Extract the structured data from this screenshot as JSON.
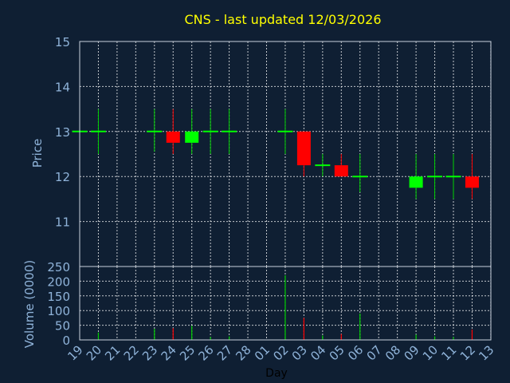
{
  "colors": {
    "background": "#0f1f33",
    "title": "#ffff00",
    "axis_text": "#8fb3d9",
    "frame": "#c8d0dc",
    "grid": "#ffffff",
    "wick": "#00d000",
    "up": "#00ff00",
    "down": "#ff0000",
    "flat": "#00ff00"
  },
  "chart_data": [
    {
      "type": "candlestick",
      "title": "CNS - last updated 12/03/2026",
      "ylabel": "Price",
      "ylim": [
        10,
        15
      ],
      "yticks": [
        11,
        12,
        13,
        14,
        15
      ],
      "grid": true,
      "categories": [
        "19",
        "20",
        "21",
        "22",
        "23",
        "24",
        "25",
        "26",
        "27",
        "28",
        "01",
        "02",
        "03",
        "04",
        "05",
        "06",
        "07",
        "08",
        "09",
        "10",
        "11",
        "12",
        "13"
      ],
      "candles": [
        {
          "x": "19",
          "open": 13.0,
          "high": 13.0,
          "low": 13.0,
          "close": 13.0
        },
        {
          "x": "20",
          "open": 13.0,
          "high": 13.5,
          "low": 12.5,
          "close": 13.0
        },
        {
          "x": "23",
          "open": 13.0,
          "high": 13.5,
          "low": 12.55,
          "close": 13.0
        },
        {
          "x": "24",
          "open": 13.0,
          "high": 13.5,
          "low": 12.5,
          "close": 12.75
        },
        {
          "x": "25",
          "open": 12.75,
          "high": 13.5,
          "low": 12.5,
          "close": 13.0
        },
        {
          "x": "26",
          "open": 13.0,
          "high": 13.5,
          "low": 12.5,
          "close": 13.0
        },
        {
          "x": "27",
          "open": 13.0,
          "high": 13.5,
          "low": 12.5,
          "close": 13.0
        },
        {
          "x": "02",
          "open": 13.0,
          "high": 13.5,
          "low": 12.5,
          "close": 13.0
        },
        {
          "x": "03",
          "open": 13.0,
          "high": 13.0,
          "low": 12.0,
          "close": 12.25
        },
        {
          "x": "04",
          "open": 12.25,
          "high": 12.5,
          "low": 12.0,
          "close": 12.25
        },
        {
          "x": "05",
          "open": 12.25,
          "high": 12.5,
          "low": 12.0,
          "close": 12.0
        },
        {
          "x": "06",
          "open": 12.0,
          "high": 12.5,
          "low": 11.65,
          "close": 12.0
        },
        {
          "x": "09",
          "open": 11.75,
          "high": 12.5,
          "low": 11.5,
          "close": 12.0
        },
        {
          "x": "10",
          "open": 12.0,
          "high": 12.5,
          "low": 11.5,
          "close": 12.0
        },
        {
          "x": "11",
          "open": 12.0,
          "high": 12.5,
          "low": 11.5,
          "close": 12.0
        },
        {
          "x": "12",
          "open": 12.0,
          "high": 12.5,
          "low": 11.5,
          "close": 11.75
        }
      ]
    },
    {
      "type": "bar",
      "ylabel": "Volume (0000)",
      "xlabel": "Day",
      "ylim": [
        0,
        250
      ],
      "yticks": [
        0,
        50,
        100,
        150,
        200,
        250
      ],
      "grid": true,
      "categories": [
        "19",
        "20",
        "21",
        "22",
        "23",
        "24",
        "25",
        "26",
        "27",
        "28",
        "01",
        "02",
        "03",
        "04",
        "05",
        "06",
        "07",
        "08",
        "09",
        "10",
        "11",
        "12",
        "13"
      ],
      "bars": [
        {
          "x": "20",
          "value": 25,
          "dir": "up"
        },
        {
          "x": "23",
          "value": 38,
          "dir": "up"
        },
        {
          "x": "24",
          "value": 40,
          "dir": "down"
        },
        {
          "x": "25",
          "value": 48,
          "dir": "up"
        },
        {
          "x": "26",
          "value": 10,
          "dir": "up"
        },
        {
          "x": "27",
          "value": 12,
          "dir": "up"
        },
        {
          "x": "02",
          "value": 220,
          "dir": "up"
        },
        {
          "x": "03",
          "value": 75,
          "dir": "down"
        },
        {
          "x": "04",
          "value": 15,
          "dir": "up"
        },
        {
          "x": "05",
          "value": 20,
          "dir": "down"
        },
        {
          "x": "06",
          "value": 90,
          "dir": "up"
        },
        {
          "x": "09",
          "value": 18,
          "dir": "up"
        },
        {
          "x": "10",
          "value": 12,
          "dir": "up"
        },
        {
          "x": "11",
          "value": 10,
          "dir": "up"
        },
        {
          "x": "12",
          "value": 35,
          "dir": "down"
        }
      ]
    }
  ]
}
